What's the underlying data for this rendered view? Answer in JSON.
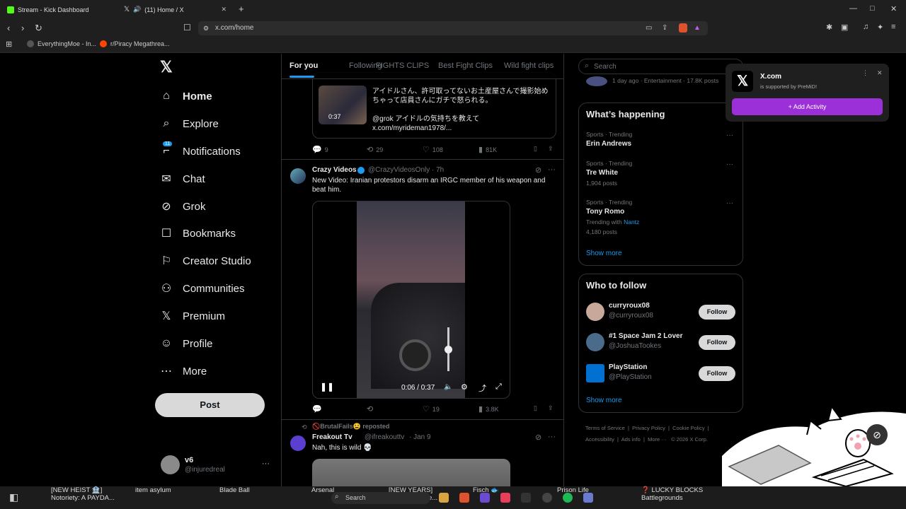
{
  "browser": {
    "tabs": [
      {
        "label": "Stream - Kick Dashboard",
        "color": "#53fc18"
      },
      {
        "label": "(11) Home / X",
        "color": "#ffffff"
      }
    ],
    "url": "x.com/home",
    "bookmarks": [
      "EverythingMoe - In...",
      "r/Piracy Megathrea..."
    ],
    "window_controls": [
      "—",
      "□",
      "✕"
    ],
    "new_tab": "+",
    "tab_close": "✕"
  },
  "sidebar": {
    "logo": "𝕏",
    "items": [
      {
        "label": "Home",
        "icon": "home-icon",
        "glyph": "⌂"
      },
      {
        "label": "Explore",
        "icon": "search-icon",
        "glyph": "⌕"
      },
      {
        "label": "Notifications",
        "icon": "bell-icon",
        "glyph": "⌐"
      },
      {
        "label": "Chat",
        "icon": "mail-icon",
        "glyph": "✉"
      },
      {
        "label": "Grok",
        "icon": "grok-icon",
        "glyph": "⊘"
      },
      {
        "label": "Bookmarks",
        "icon": "bookmark-icon",
        "glyph": "☐"
      },
      {
        "label": "Creator Studio",
        "icon": "creator-icon",
        "glyph": "⚐"
      },
      {
        "label": "Communities",
        "icon": "communities-icon",
        "glyph": "⚇"
      },
      {
        "label": "Premium",
        "icon": "x-icon",
        "glyph": "𝕏"
      },
      {
        "label": "Profile",
        "icon": "person-icon",
        "glyph": "☺"
      },
      {
        "label": "More",
        "icon": "more-circle-icon",
        "glyph": "⋯"
      }
    ],
    "notif_badge": "11",
    "post_label": "Post",
    "user": {
      "name": "v6",
      "handle": "@injuredreal",
      "more": "···"
    }
  },
  "feed": {
    "tabs": [
      "For you",
      "Following",
      "FIGHTS CLIPS",
      "Best Fight Clips",
      "Wild fight clips"
    ],
    "quoted": {
      "line1": "アイドルさん、許可取ってないお土産屋さんで撮影始め",
      "line2": "ちゃって店員さんにガチで怒られる。",
      "line3": "@grok アイドルの気持ちを教えて",
      "line4": "x.com/myrideman1978/...",
      "duration": "0:37"
    },
    "post1_actions": {
      "replies": "9",
      "reposts": "29",
      "likes": "108",
      "views": "81K"
    },
    "post2": {
      "name": "Crazy Videos",
      "handle": "@CrazyVideosOnly",
      "time": "· 7h",
      "text": "New Video: Iranian protestors disarm an IRGC member of his weapon and beat him.",
      "video_time": "0:06 / 0:37",
      "actions": {
        "replies": "",
        "reposts": "",
        "likes": "19",
        "views": "3.8K"
      }
    },
    "post3": {
      "reposted_by": "🚫BrutalFails😫 reposted",
      "name": "Freakout Tv",
      "handle": "@ifreakouttv",
      "time": "· Jan 9",
      "text": "Nah, this is wild 💀"
    }
  },
  "right": {
    "search_placeholder": "Search",
    "top_meta": "1 day ago · Entertainment · 17.8K posts",
    "happening_title": "What’s happening",
    "trends": [
      {
        "meta": "Sports · Trending",
        "name": "Erin Andrews",
        "extra": ""
      },
      {
        "meta": "Sports · Trending",
        "name": "Tre White",
        "extra": "1,904 posts"
      },
      {
        "meta": "Sports · Trending",
        "name": "Tony Romo",
        "extra": "4,180 posts",
        "with_label": "Trending with",
        "with_link": "Nantz"
      }
    ],
    "show_more": "Show more",
    "follow_title": "Who to follow",
    "follows": [
      {
        "name": "curryroux08",
        "handle": "@curryroux08",
        "btn": "Follow",
        "color": "#c8a89a"
      },
      {
        "name": "#1 Space Jam 2 Lover",
        "handle": "@JoshuaTookes",
        "btn": "Follow",
        "color": "#4a6b8a"
      },
      {
        "name": "PlayStation",
        "handle": "@PlayStation",
        "btn": "Follow",
        "color": "#0070d1"
      }
    ],
    "show_more2": "Show more",
    "footer": [
      "Terms of Service",
      "Privacy Policy",
      "Cookie Policy",
      "Accessibility",
      "Ads info",
      "More ···",
      "© 2026 X Corp."
    ]
  },
  "premid": {
    "title": "X.com",
    "sub": "is supported by PreMiD!",
    "btn": "+ Add Activity",
    "accent": "#9b30d9"
  },
  "taskbar": {
    "items": [
      {
        "l1": "[NEW HEIST 🏦]",
        "l2": "Notoriety: A PAYDA..."
      },
      {
        "l1": "item asylum",
        "l2": ""
      },
      {
        "l1": "Blade Ball",
        "l2": ""
      },
      {
        "l1": "Arsenal",
        "l2": ""
      },
      {
        "l1": "[NEW YEARS]",
        "l2": "Random ... Re..."
      },
      {
        "l1": "Fisch 🐟",
        "l2": ""
      },
      {
        "l1": "Prison Life",
        "l2": ""
      },
      {
        "l1": "❓ LUCKY BLOCKS",
        "l2": "Battlegrounds"
      }
    ],
    "search": "Search"
  }
}
